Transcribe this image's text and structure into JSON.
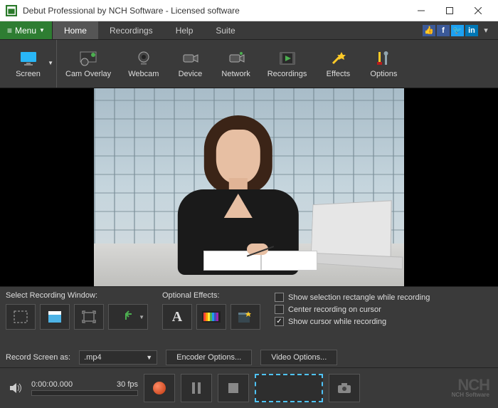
{
  "window": {
    "title": "Debut Professional by NCH Software - Licensed software"
  },
  "menu": {
    "button": "Menu",
    "tabs": [
      "Home",
      "Recordings",
      "Help",
      "Suite"
    ],
    "active": 0
  },
  "toolbar": [
    {
      "label": "Screen"
    },
    {
      "label": "Cam Overlay"
    },
    {
      "label": "Webcam"
    },
    {
      "label": "Device"
    },
    {
      "label": "Network"
    },
    {
      "label": "Recordings"
    },
    {
      "label": "Effects"
    },
    {
      "label": "Options"
    }
  ],
  "panels": {
    "select_window_label": "Select Recording Window:",
    "effects_label": "Optional Effects:",
    "checks": {
      "show_selection": {
        "label": "Show selection rectangle while recording",
        "checked": false
      },
      "center_cursor": {
        "label": "Center recording on cursor",
        "checked": false
      },
      "show_cursor": {
        "label": "Show cursor while recording",
        "checked": true
      }
    }
  },
  "record": {
    "label": "Record Screen as:",
    "format": ".mp4",
    "encoder_btn": "Encoder Options...",
    "video_btn": "Video Options..."
  },
  "controls": {
    "time": "0:00:00.000",
    "fps": "30 fps"
  },
  "brand": {
    "name": "NCH",
    "sub": "NCH Software"
  }
}
